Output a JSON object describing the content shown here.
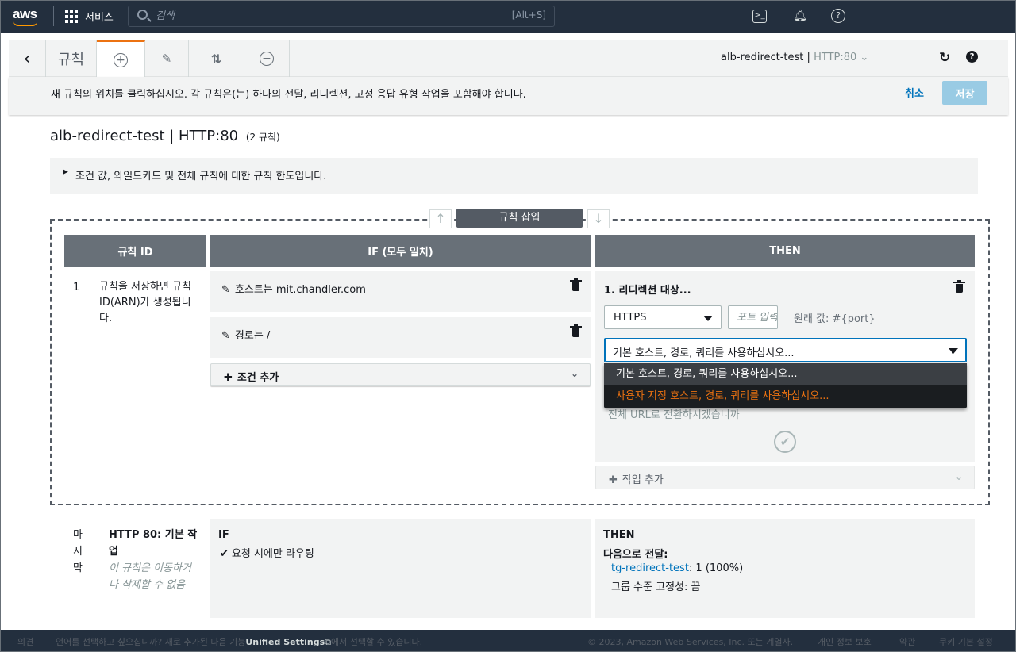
{
  "nav": {
    "logo": "aws",
    "services": "서비스",
    "search_placeholder": "검색",
    "search_shortcut": "[Alt+S]",
    "icons": [
      "cloudshell-icon",
      "bell-icon",
      "help-icon"
    ]
  },
  "toolbar": {
    "title": "규칙",
    "listener_name": "alb-redirect-test",
    "listener_sep": "|",
    "listener_port": "HTTP:80",
    "icons": [
      "back-icon",
      "add-icon",
      "pencil-icon",
      "reorder-icon",
      "minus-icon",
      "refresh-icon",
      "help-icon"
    ]
  },
  "infobar": {
    "text": "새 규칙의 위치를 클릭하십시오. 각 규칙은(는) 하나의 전달, 리디렉션, 고정 응답 유형 작업을 포함해야 합니다.",
    "cancel": "취소",
    "save": "저장"
  },
  "header": {
    "title": "alb-redirect-test | HTTP:80",
    "count": "(2 규칙)",
    "limits": "조건 값, 와일드카드 및 전체 규칙에 대한 규칙 한도입니다."
  },
  "insert": {
    "label": "규칙 삽입",
    "up": "↑",
    "down": "↓"
  },
  "columns": {
    "rule_id": "규칙 ID",
    "if": "IF (모두 일치)",
    "then": "THEN"
  },
  "new_rule": {
    "number": "1",
    "note": "규칙을 저장하면 규칙 ID(ARN)가 생성됩니다.",
    "conditions": [
      {
        "label": "호스트는 mit.chandler.com"
      },
      {
        "label": "경로는 /"
      }
    ],
    "add_condition": "조건 추가",
    "action_title": "1. 리디렉션 대상...",
    "protocol": "HTTPS",
    "port_placeholder": "포트 입력",
    "original_value": "원래 값: #{port}",
    "url_mode": "기본 호스트, 경로, 쿼리를 사용하십시오...",
    "url_options": [
      "기본 호스트, 경로, 쿼리를 사용하십시오...",
      "사용자 지정 호스트, 경로, 쿼리를 사용하십시오..."
    ],
    "redirect_hint": "전체 URL로 전환하시겠습니까",
    "add_action": "작업 추가"
  },
  "default_rule": {
    "last_label": "마지막",
    "title": "HTTP 80: 기본 작업",
    "note": "이 규칙은 이동하거나 삭제할 수 없음",
    "if_label": "IF",
    "if_text": "요청 시에만 라우팅",
    "then_label": "THEN",
    "forward_label": "다음으로 전달:",
    "target_group": "tg-redirect-test",
    "weight": ": 1 (100%)",
    "stickiness": "그룹 수준 고정성: 끔"
  },
  "footer": {
    "feedback": "의견",
    "lang_prefix": "언어를 선택하고 싶으십니까? 새로 추가된 다음 기능",
    "lang_link": "Unified Settings",
    "lang_suffix": "에서 선택할 수 있습니다.",
    "copyright": "© 2023, Amazon Web Services, Inc. 또는 계열사.",
    "privacy": "개인 정보 보호",
    "terms": "약관",
    "cookies": "쿠키 기본 설정"
  },
  "colors": {
    "nav_bg": "#232f3e",
    "accent_orange": "#ec7211",
    "link_blue": "#0073bb",
    "header_gray": "#687078"
  }
}
